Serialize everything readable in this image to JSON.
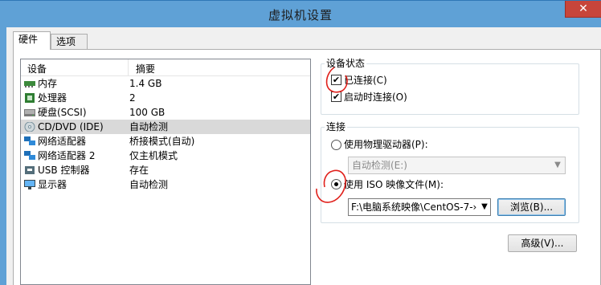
{
  "window": {
    "title": "虚拟机设置",
    "close_glyph": "✕"
  },
  "tabs": [
    {
      "label": "硬件"
    },
    {
      "label": "选项"
    }
  ],
  "devices": {
    "col_device": "设备",
    "col_summary": "摘要",
    "rows": [
      {
        "name": "内存",
        "summary": "1.4 GB",
        "icon": "memory-icon"
      },
      {
        "name": "处理器",
        "summary": "2",
        "icon": "processor-icon"
      },
      {
        "name": "硬盘(SCSI)",
        "summary": "100 GB",
        "icon": "hard-disk-icon"
      },
      {
        "name": "CD/DVD (IDE)",
        "summary": "自动检测",
        "icon": "cd-dvd-icon"
      },
      {
        "name": "网络适配器",
        "summary": "桥接模式(自动)",
        "icon": "network-adapter-icon"
      },
      {
        "name": "网络适配器 2",
        "summary": "仅主机模式",
        "icon": "network-adapter-icon"
      },
      {
        "name": "USB 控制器",
        "summary": "存在",
        "icon": "usb-icon"
      },
      {
        "name": "显示器",
        "summary": "自动检测",
        "icon": "display-icon"
      }
    ]
  },
  "device_status": {
    "title": "设备状态",
    "connected": {
      "label": "已连接(C)",
      "checked": true
    },
    "connect_at_power_on": {
      "label": "启动时连接(O)",
      "checked": true
    }
  },
  "connection": {
    "title": "连接",
    "physical": {
      "label": "使用物理驱动器(P):",
      "selected": false,
      "drive_value": "自动检测(E:)"
    },
    "iso": {
      "label": "使用 ISO 映像文件(M):",
      "selected": true,
      "path": "F:\\电脑系统映像\\CentOS-7-›"
    },
    "browse_button": "浏览(B)...",
    "advanced_button": "高级(V)..."
  },
  "annotation_color": "#e0201b"
}
